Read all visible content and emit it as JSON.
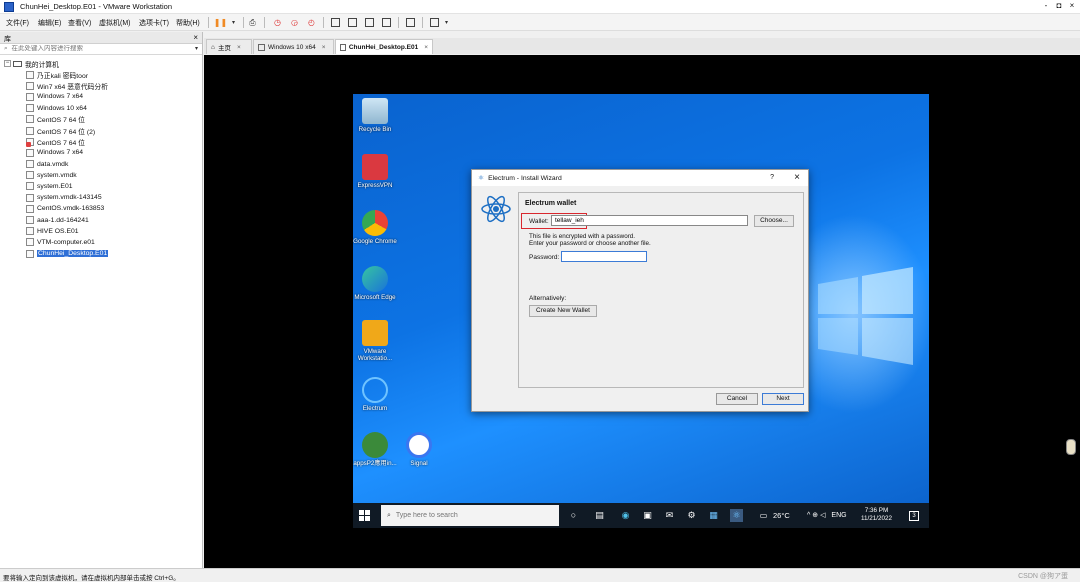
{
  "window": {
    "title": "ChunHei_Desktop.E01 - VMware Workstation",
    "min": "-",
    "max": "◘",
    "close": "×"
  },
  "menu": [
    "文件(F)",
    "编辑(E)",
    "查看(V)",
    "虚拟机(M)",
    "选项卡(T)",
    "帮助(H)"
  ],
  "sidebar": {
    "header": "库",
    "close": "×",
    "search_placeholder": "在此处键入内容进行搜索",
    "root": "我的计算机",
    "items": [
      {
        "label": "乃正kali 密码toor"
      },
      {
        "label": "Win7 x64 恶意代码分析"
      },
      {
        "label": "Windows 7 x64"
      },
      {
        "label": "Windows 10 x64"
      },
      {
        "label": "CentOS 7 64 位"
      },
      {
        "label": "CentOS 7 64 位 (2)"
      },
      {
        "label": "CentOS 7 64 位"
      },
      {
        "label": "Windows 7 x64"
      },
      {
        "label": "data.vmdk"
      },
      {
        "label": "system.vmdk"
      },
      {
        "label": "system.E01"
      },
      {
        "label": "system.vmdk-143145"
      },
      {
        "label": "CentOS.vmdk-163853"
      },
      {
        "label": "aaa-1.dd-164241"
      },
      {
        "label": "HIVE OS.E01"
      },
      {
        "label": "VTM-computer.e01"
      },
      {
        "label": "ChunHei_Desktop.E01"
      }
    ]
  },
  "tabs": [
    {
      "label": "主页"
    },
    {
      "label": "Windows 10 x64"
    },
    {
      "label": "ChunHei_Desktop.E01"
    }
  ],
  "desktop_icons": [
    {
      "label": "Recycle Bin"
    },
    {
      "label": "ExpressVPN"
    },
    {
      "label": "Google Chrome"
    },
    {
      "label": "Microsoft Edge"
    },
    {
      "label": "VMware Workstatio..."
    },
    {
      "label": "Electrum"
    },
    {
      "label": "appsP2應用in..."
    },
    {
      "label": "Signal"
    }
  ],
  "dialog": {
    "title": "Electrum  -  Install Wizard",
    "help": "?",
    "close": "×",
    "heading": "Electrum wallet",
    "wallet_label": "Wallet:",
    "wallet_value": "tellaw_ieh",
    "choose": "Choose...",
    "info_line1": "This file is encrypted with a password.",
    "info_line2": "Enter your password or choose another file.",
    "password_label": "Password:",
    "alternatively": "Alternatively:",
    "create_new": "Create New Wallet",
    "cancel": "Cancel",
    "next": "Next"
  },
  "taskbar": {
    "search_placeholder": "Type here to search",
    "weather": "26°C",
    "lang": "ENG",
    "time": "7:36 PM",
    "date": "11/21/2022",
    "notif": "3"
  },
  "status": {
    "text": "要将输入定向到该虚拟机，请在虚拟机内部单击或按 Ctrl+G。",
    "watermark": "CSDN @狗ア蛋"
  }
}
